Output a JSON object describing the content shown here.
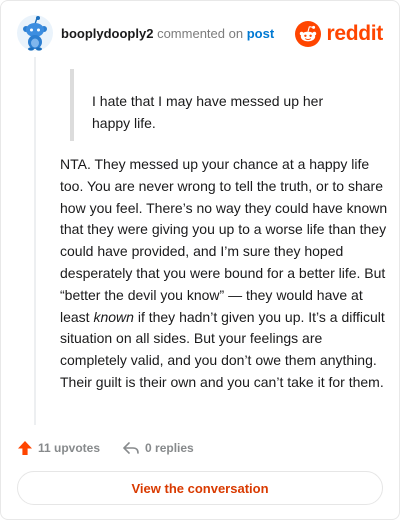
{
  "header": {
    "username": "booplydooply2",
    "commented_text": "commented on",
    "post_link": "post",
    "brand": "reddit"
  },
  "quote": {
    "text": "I hate that I may have messed up her happy life."
  },
  "comment": {
    "part1": "NTA. They messed up your chance at a happy life too. You are never wrong to tell the truth, or to share how you feel. There’s no way they could have known that they were giving you up to a worse life than they could have provided, and I’m sure they hoped desperately that you were bound for a better life. But “better the devil you know” — they would have at least ",
    "emphasis": "known",
    "part2": " if they hadn’t given you up. It’s a difficult situation on all sides. But your feelings are completely valid, and you don’t owe them anything. Their guilt is their own and you can’t take it for them."
  },
  "actions": {
    "upvotes": "11 upvotes",
    "replies": "0 replies"
  },
  "footer": {
    "button_label": "View the conversation"
  },
  "colors": {
    "brand": "#ff4500",
    "link": "#0079d3",
    "button_text": "#d93a00"
  },
  "icons": {
    "avatar": "snoo-avatar-icon",
    "brand": "reddit-logo-icon",
    "upvote": "upvote-arrow-icon",
    "reply": "reply-arrow-icon"
  }
}
